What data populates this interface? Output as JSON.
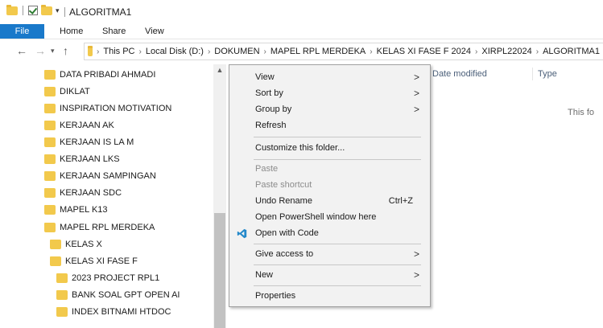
{
  "window": {
    "title": "ALGORITMA1"
  },
  "ribbon": {
    "file": "File",
    "tabs": [
      "Home",
      "Share",
      "View"
    ]
  },
  "address": {
    "crumbs": [
      "This PC",
      "Local Disk (D:)",
      "DOKUMEN",
      "MAPEL RPL MERDEKA",
      "KELAS XI FASE F 2024",
      "XIRPL22024",
      "ALGORITMA1"
    ]
  },
  "tree": {
    "items": [
      {
        "label": "DATA PRIBADI AHMADI",
        "level": 1
      },
      {
        "label": "DIKLAT",
        "level": 1
      },
      {
        "label": "INSPIRATION MOTIVATION",
        "level": 1
      },
      {
        "label": "KERJAAN AK",
        "level": 1
      },
      {
        "label": "KERJAAN IS LA M",
        "level": 1
      },
      {
        "label": "KERJAAN LKS",
        "level": 1
      },
      {
        "label": "KERJAAN SAMPINGAN",
        "level": 1
      },
      {
        "label": "KERJAAN SDC",
        "level": 1
      },
      {
        "label": "MAPEL K13",
        "level": 1
      },
      {
        "label": "MAPEL RPL MERDEKA",
        "level": 1
      },
      {
        "label": "KELAS X",
        "level": 2
      },
      {
        "label": "KELAS XI FASE F",
        "level": 2
      },
      {
        "label": "2023 PROJECT RPL1",
        "level": 3
      },
      {
        "label": "BANK SOAL GPT OPEN AI",
        "level": 3
      },
      {
        "label": "INDEX BITNAMI HTDOC",
        "level": 3
      }
    ]
  },
  "columns": {
    "date_modified": "Date modified",
    "type": "Type"
  },
  "content": {
    "empty_message": "This fo"
  },
  "context_menu": {
    "view": "View",
    "sort_by": "Sort by",
    "group_by": "Group by",
    "refresh": "Refresh",
    "customize": "Customize this folder...",
    "paste": "Paste",
    "paste_shortcut": "Paste shortcut",
    "undo_rename": "Undo Rename",
    "undo_shortcut": "Ctrl+Z",
    "powershell": "Open PowerShell window here",
    "open_code": "Open with Code",
    "give_access": "Give access to",
    "new": "New",
    "properties": "Properties"
  },
  "colors": {
    "file_tab": "#1979ca",
    "folder": "#f2c94c",
    "vscode": "#2489ca"
  }
}
